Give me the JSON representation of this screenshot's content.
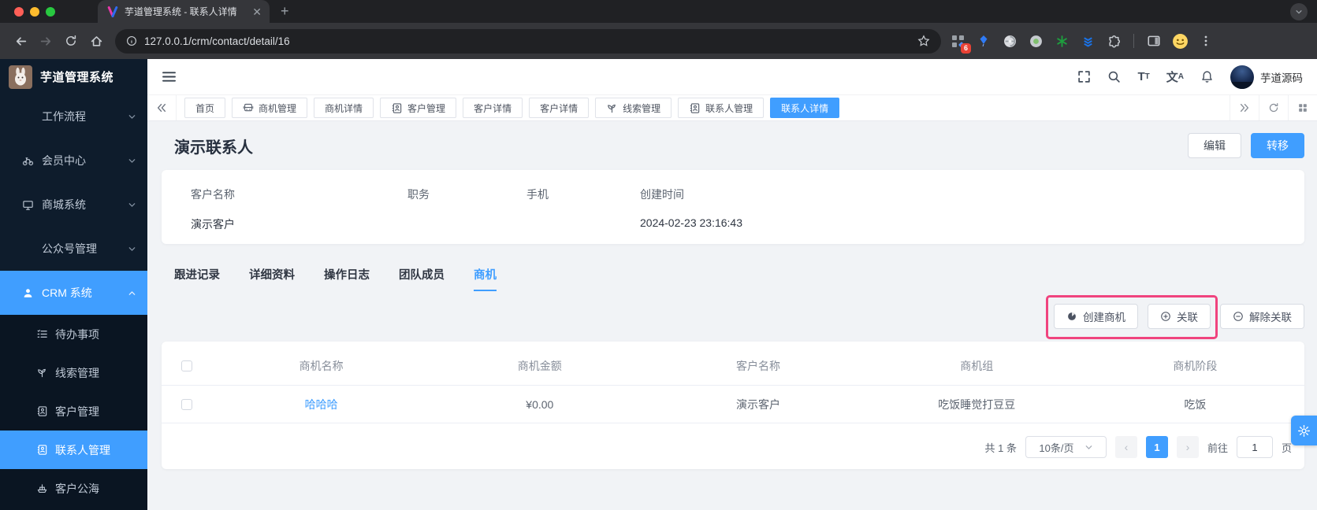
{
  "browser": {
    "tab_title": "芋道管理系统 - 联系人详情",
    "url": "127.0.0.1/crm/contact/detail/16",
    "extension_badge": "6"
  },
  "header": {
    "logo_title": "芋道管理系统",
    "username": "芋道源码"
  },
  "sidebar": {
    "items": [
      {
        "label": "工作流程",
        "icon": "",
        "chevron": "down",
        "active": false
      },
      {
        "label": "会员中心",
        "icon": "bike-icon",
        "chevron": "down",
        "active": false
      },
      {
        "label": "商城系统",
        "icon": "shop-icon",
        "chevron": "down",
        "active": false
      },
      {
        "label": "公众号管理",
        "icon": "",
        "chevron": "down",
        "active": false
      },
      {
        "label": "CRM 系统",
        "icon": "user-icon",
        "chevron": "up",
        "active": true
      }
    ],
    "subitems": [
      {
        "label": "待办事项",
        "icon": "todo-list-icon",
        "active": false
      },
      {
        "label": "线索管理",
        "icon": "seedling-icon",
        "active": false
      },
      {
        "label": "客户管理",
        "icon": "contacts-icon",
        "active": false
      },
      {
        "label": "联系人管理",
        "icon": "contacts-icon",
        "active": true
      },
      {
        "label": "客户公海",
        "icon": "ship-icon",
        "active": false
      }
    ]
  },
  "tagbar": {
    "tabs": [
      {
        "label": "首页",
        "icon": "",
        "active": false
      },
      {
        "label": "商机管理",
        "icon": "van-icon",
        "active": false
      },
      {
        "label": "商机详情",
        "icon": "",
        "active": false
      },
      {
        "label": "客户管理",
        "icon": "contacts-icon",
        "active": false
      },
      {
        "label": "客户详情",
        "icon": "",
        "active": false
      },
      {
        "label": "客户详情",
        "icon": "",
        "active": false
      },
      {
        "label": "线索管理",
        "icon": "seedling-icon",
        "active": false
      },
      {
        "label": "联系人管理",
        "icon": "contacts-icon",
        "active": false
      },
      {
        "label": "联系人详情",
        "icon": "",
        "active": true
      }
    ]
  },
  "page": {
    "title": "演示联系人",
    "edit_label": "编辑",
    "transfer_label": "转移"
  },
  "info": {
    "fields": [
      {
        "label": "客户名称",
        "value": "演示客户"
      },
      {
        "label": "职务",
        "value": ""
      },
      {
        "label": "手机",
        "value": ""
      },
      {
        "label": "创建时间",
        "value": "2024-02-23 23:16:43"
      }
    ]
  },
  "detail_tabs": [
    {
      "label": "跟进记录",
      "active": false
    },
    {
      "label": "详细资料",
      "active": false
    },
    {
      "label": "操作日志",
      "active": false
    },
    {
      "label": "团队成员",
      "active": false
    },
    {
      "label": "商机",
      "active": true
    }
  ],
  "actions": {
    "create_label": "创建商机",
    "link_label": "关联",
    "unlink_label": "解除关联"
  },
  "table": {
    "columns": [
      "商机名称",
      "商机金额",
      "客户名称",
      "商机组",
      "商机阶段"
    ],
    "rows": [
      {
        "cells": [
          "哈哈哈",
          "¥0.00",
          "演示客户",
          "吃饭睡觉打豆豆",
          "吃饭"
        ]
      }
    ]
  },
  "pagination": {
    "total": "共 1 条",
    "page_size": "10条/页",
    "pages": [
      "1"
    ],
    "current": "1",
    "goto_label": "前往",
    "goto_value": "1",
    "unit_label": "页"
  },
  "colors": {
    "primary": "#409eff",
    "annotation": "#f0437e",
    "sidebar_bg": "#0e1c2c",
    "sidebar_sub_bg": "#0a1522"
  }
}
